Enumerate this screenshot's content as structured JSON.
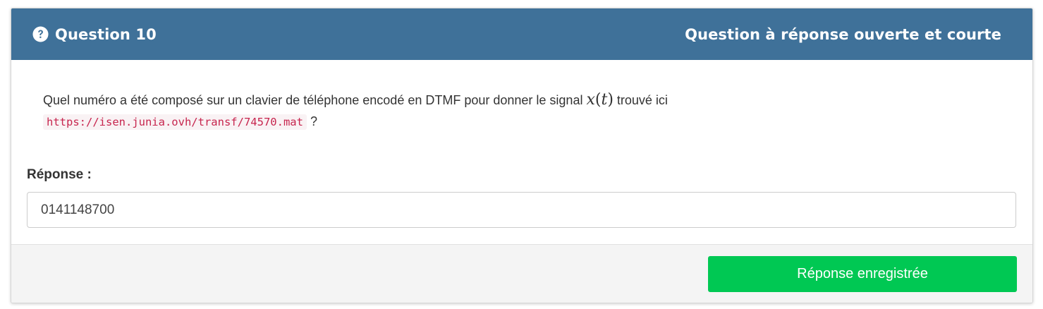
{
  "header": {
    "icon": "question-circle-icon",
    "title": "Question 10",
    "type_label": "Question à réponse ouverte et courte",
    "background_color": "#3f7199"
  },
  "question": {
    "text_before": "Quel numéro a été composé sur un clavier de téléphone encodé en DTMF pour donner le signal ",
    "math_var": "x",
    "math_arg": "t",
    "text_after": " trouvé ici",
    "link": "https://isen.junia.ovh/transf/74570.mat",
    "end_mark": " ?"
  },
  "answer": {
    "label": "Réponse :",
    "value": "0141148700"
  },
  "footer": {
    "button_label": "Réponse enregistrée",
    "button_color": "#00c853"
  }
}
